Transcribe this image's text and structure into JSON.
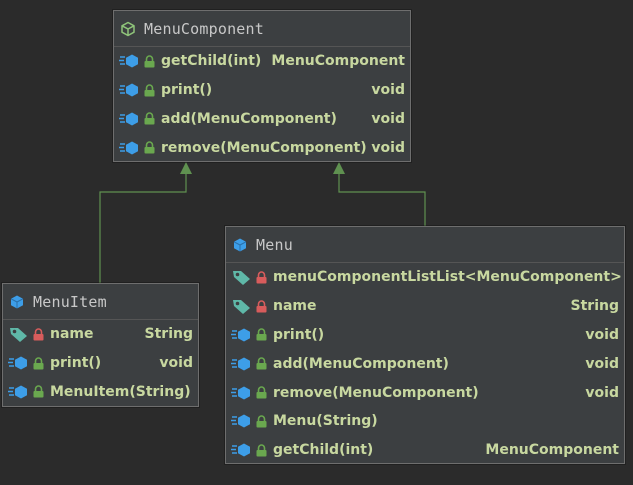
{
  "nodes": {
    "menu_component": {
      "title": "MenuComponent",
      "members": [
        {
          "kind": "method",
          "name": "getChild(int)",
          "type": "MenuComponent"
        },
        {
          "kind": "method",
          "name": "print()",
          "type": "void"
        },
        {
          "kind": "method",
          "name": "add(MenuComponent)",
          "type": "void"
        },
        {
          "kind": "method",
          "name": "remove(MenuComponent)",
          "type": "void"
        }
      ]
    },
    "menu_item": {
      "title": "MenuItem",
      "members": [
        {
          "kind": "field",
          "name": "name",
          "type": "String"
        },
        {
          "kind": "method",
          "name": "print()",
          "type": "void"
        },
        {
          "kind": "constructor",
          "name": "MenuItem(String)",
          "type": ""
        }
      ]
    },
    "menu": {
      "title": "Menu",
      "members": [
        {
          "kind": "field",
          "name": "menuComponentList",
          "type": "List<MenuComponent>"
        },
        {
          "kind": "field",
          "name": "name",
          "type": "String"
        },
        {
          "kind": "method",
          "name": "print()",
          "type": "void"
        },
        {
          "kind": "method",
          "name": "add(MenuComponent)",
          "type": "void"
        },
        {
          "kind": "method",
          "name": "remove(MenuComponent)",
          "type": "void"
        },
        {
          "kind": "constructor",
          "name": "Menu(String)",
          "type": ""
        },
        {
          "kind": "method",
          "name": "getChild(int)",
          "type": "MenuComponent"
        }
      ]
    }
  },
  "edges": [
    {
      "from": "menu_item",
      "to": "menu_component",
      "kind": "generalization"
    },
    {
      "from": "menu",
      "to": "menu_component",
      "kind": "generalization"
    }
  ],
  "colors": {
    "background": "#2b2b2b",
    "node_fill": "#3c3f41",
    "member_text": "#c8d8a0",
    "edge": "#5f9150",
    "interface_icon": "#8fc47a",
    "class_icon": "#3d9ee8",
    "field_icon": "#5fb8a8",
    "lock_private": "#d85c5c",
    "lock_public": "#6aa84f"
  }
}
